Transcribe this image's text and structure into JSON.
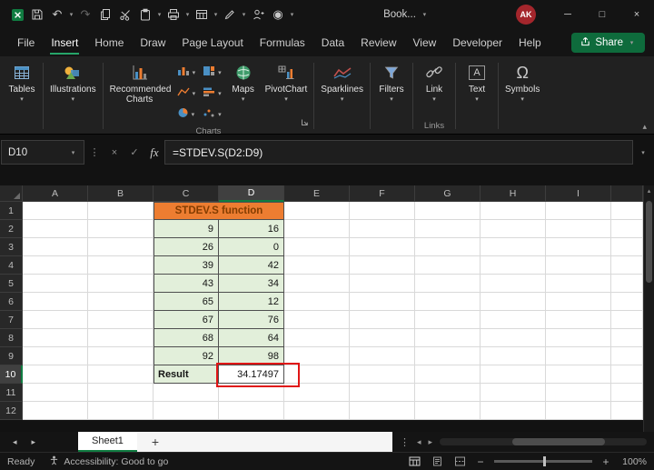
{
  "icons": {
    "chevron-down": "▾",
    "chevron-up": "▴",
    "ellipsis-v": "⋮",
    "arrow-left": "◂",
    "arrow-right": "▸",
    "arrow-up": "▴",
    "arrow-down": "▾",
    "plus": "+",
    "minus": "−",
    "close": "×",
    "minimize": "─",
    "maximize": "□",
    "undo": "↶",
    "redo": "↷",
    "check": "✓",
    "cancel": "×",
    "record": "◉",
    "omega": "Ω",
    "letter-a": "A"
  },
  "titlebar": {
    "title": "Book...",
    "avatar_initials": "AK"
  },
  "menubar": {
    "items": [
      "File",
      "Insert",
      "Home",
      "Draw",
      "Page Layout",
      "Formulas",
      "Data",
      "Review",
      "View",
      "Developer",
      "Help"
    ],
    "share_label": "Share"
  },
  "ribbon": {
    "tables": "Tables",
    "illustrations": "Illustrations",
    "recommended_charts": "Recommended Charts",
    "maps": "Maps",
    "pivotchart": "PivotChart",
    "sparklines": "Sparklines",
    "filters": "Filters",
    "link": "Link",
    "text": "Text",
    "symbols": "Symbols",
    "charts_group_label": "Charts",
    "links_group_label": "Links"
  },
  "formula_bar": {
    "name_box": "D10",
    "fx": "fx",
    "formula": "=STDEV.S(D2:D9)"
  },
  "grid": {
    "columns": [
      "A",
      "B",
      "C",
      "D",
      "E",
      "F",
      "G",
      "H",
      "I"
    ],
    "row_count": 12,
    "selection": {
      "column": "D",
      "row": 10
    },
    "title": "STDEV.S function",
    "col_c": [
      "9",
      "26",
      "39",
      "43",
      "65",
      "67",
      "68",
      "92"
    ],
    "col_d": [
      "16",
      "0",
      "42",
      "34",
      "12",
      "76",
      "64",
      "98"
    ],
    "result_label": "Result",
    "result_value": "34.17497"
  },
  "sheet_bar": {
    "active_tab": "Sheet1"
  },
  "status_bar": {
    "mode": "Ready",
    "accessibility": "Accessibility: Good to go",
    "zoom": "100%"
  }
}
